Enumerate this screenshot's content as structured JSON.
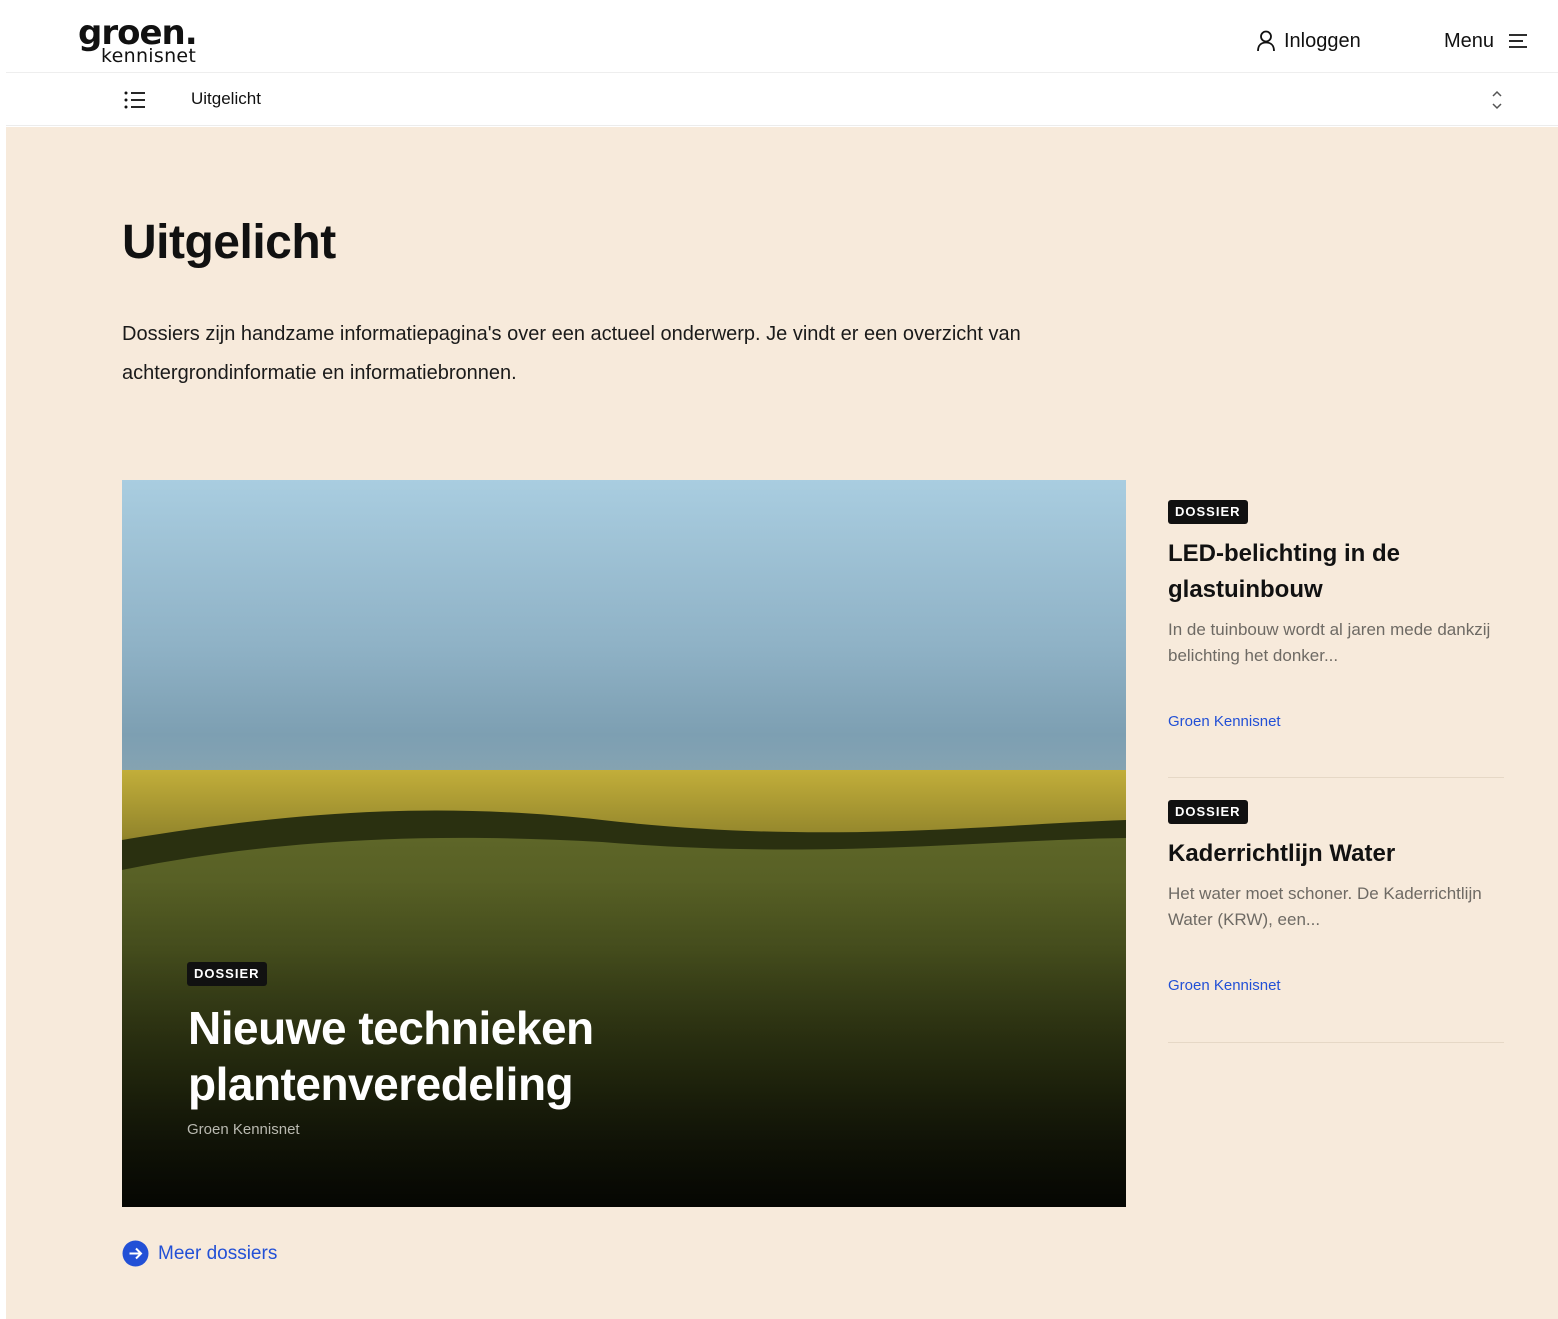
{
  "header": {
    "logo_main": "groen.",
    "logo_sub": "kennisnet",
    "login_label": "Inloggen",
    "menu_label": "Menu"
  },
  "subnav": {
    "current": "Uitgelicht"
  },
  "page": {
    "title": "Uitgelicht",
    "intro": "Dossiers zijn handzame informatiepagina's over een actueel onderwerp. Je vindt er een overzicht van achtergrondinformatie en informatiebronnen."
  },
  "feature": {
    "badge": "DOSSIER",
    "title": "Nieuwe technieken plantenveredeling",
    "source": "Groen Kennisnet"
  },
  "side_items": [
    {
      "badge": "DOSSIER",
      "title": "LED-belichting in de glastuinbouw",
      "description": "In de tuinbouw wordt al jaren mede dankzij belichting het donker...",
      "source": "Groen Kennisnet"
    },
    {
      "badge": "DOSSIER",
      "title": "Kaderrichtlijn Water",
      "description": "Het water moet schoner. De Kaderrichtlijn Water (KRW), een...",
      "source": "Groen Kennisnet"
    }
  ],
  "more_link": "Meer dossiers",
  "colors": {
    "background": "#f7eadb",
    "link": "#2250d6",
    "badge": "#111111"
  },
  "icons": [
    "user-icon",
    "hamburger-icon",
    "list-icon",
    "sort-icon",
    "arrow-right-circle-icon"
  ]
}
